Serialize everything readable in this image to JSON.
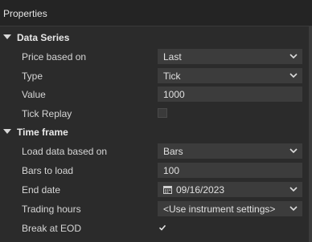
{
  "panel": {
    "title": "Properties"
  },
  "categories": [
    {
      "label": "Data Series",
      "props": [
        {
          "label": "Price based on",
          "value": "Last",
          "kind": "dropdown"
        },
        {
          "label": "Type",
          "value": "Tick",
          "kind": "dropdown"
        },
        {
          "label": "Value",
          "value": "1000",
          "kind": "text"
        },
        {
          "label": "Tick Replay",
          "checked": false,
          "kind": "checkbox"
        }
      ]
    },
    {
      "label": "Time frame",
      "props": [
        {
          "label": "Load data based on",
          "value": "Bars",
          "kind": "dropdown"
        },
        {
          "label": "Bars to load",
          "value": "100",
          "kind": "text"
        },
        {
          "label": "End date",
          "value": "09/16/2023",
          "kind": "date",
          "icon": "calendar-icon"
        },
        {
          "label": "Trading hours",
          "value": "<Use instrument settings>",
          "kind": "dropdown"
        },
        {
          "label": "Break at EOD",
          "checked": true,
          "kind": "checkbox"
        }
      ]
    }
  ],
  "icons": {
    "expand": "triangle-down-icon",
    "dropdown": "chevron-down-icon",
    "check": "checkmark-icon"
  },
  "colors": {
    "background": "#2b2b2b",
    "value_box": "#3c3c3c",
    "text": "#dcdcdc"
  }
}
